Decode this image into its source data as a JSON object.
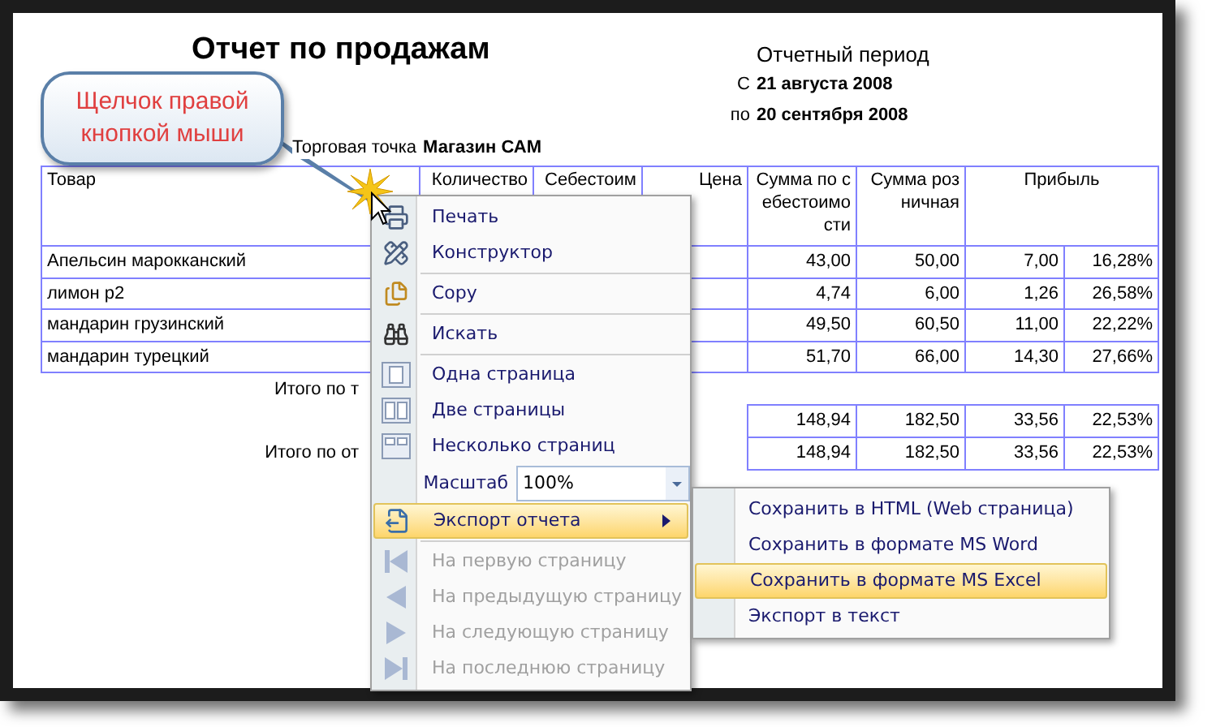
{
  "report": {
    "title": "Отчет по продажам",
    "period_label": "Отчетный период",
    "period_from": {
      "prefix": "С",
      "date": "21 августа 2008"
    },
    "period_to": {
      "prefix": "по",
      "date": "20 сентября 2008"
    },
    "store": {
      "label": "Торговая точка",
      "name": "Магазин САМ"
    }
  },
  "table": {
    "columns": [
      "Товар",
      "Количество",
      "Себестоим",
      "Цена",
      "Сумма по себестоимости",
      "Сумма розничная",
      "Прибыль"
    ],
    "rows": [
      {
        "product": "Апельсин марокканский",
        "cost_sum": "43,00",
        "retail_sum": "50,00",
        "profit": "7,00",
        "profit_pct": "16,28%"
      },
      {
        "product": "лимон p2",
        "cost_sum": "4,74",
        "retail_sum": "6,00",
        "profit": "1,26",
        "profit_pct": "26,58%"
      },
      {
        "product": "мандарин грузинский",
        "cost_sum": "49,50",
        "retail_sum": "60,50",
        "profit": "11,00",
        "profit_pct": "22,22%"
      },
      {
        "product": "мандарин турецкий",
        "cost_sum": "51,70",
        "retail_sum": "66,00",
        "profit": "14,30",
        "profit_pct": "27,66%"
      }
    ],
    "totals": [
      {
        "label": "Итого по т",
        "cost_sum": "148,94",
        "retail_sum": "182,50",
        "profit": "33,56",
        "profit_pct": "22,53%"
      },
      {
        "label": "Итого по от",
        "cost_sum": "148,94",
        "retail_sum": "182,50",
        "profit": "33,56",
        "profit_pct": "22,53%"
      }
    ]
  },
  "callout": {
    "text": "Щелчок правой кнопкой мыши"
  },
  "context_menu": {
    "items": [
      {
        "kind": "item",
        "label": "Печать",
        "disabled": false,
        "selected": false
      },
      {
        "kind": "item",
        "label": "Конструктор",
        "disabled": false,
        "selected": false
      },
      {
        "kind": "separator"
      },
      {
        "kind": "item",
        "label": "Copy",
        "disabled": false,
        "selected": false
      },
      {
        "kind": "separator"
      },
      {
        "kind": "item",
        "label": "Искать",
        "disabled": false,
        "selected": false
      },
      {
        "kind": "separator"
      },
      {
        "kind": "item",
        "label": "Одна страница",
        "disabled": false,
        "selected": false
      },
      {
        "kind": "item",
        "label": "Две страницы",
        "disabled": false,
        "selected": false
      },
      {
        "kind": "item",
        "label": "Несколько страниц",
        "disabled": false,
        "selected": false
      },
      {
        "kind": "zoom",
        "label": "Масштаб",
        "value": "100%"
      },
      {
        "kind": "submenu",
        "label": "Экспорт отчета",
        "disabled": false,
        "selected": true
      },
      {
        "kind": "separator"
      },
      {
        "kind": "item",
        "label": "На первую страницу",
        "disabled": true,
        "selected": false
      },
      {
        "kind": "item",
        "label": "На предыдущую страницу",
        "disabled": true,
        "selected": false
      },
      {
        "kind": "item",
        "label": "На следующую страницу",
        "disabled": true,
        "selected": false
      },
      {
        "kind": "item",
        "label": "На последнюю страницу",
        "disabled": true,
        "selected": false
      }
    ]
  },
  "submenu": {
    "items": [
      {
        "label": "Сохранить в HTML (Web страница)",
        "selected": false
      },
      {
        "label": "Сохранить в формате MS Word",
        "selected": false
      },
      {
        "label": "Сохранить в формате MS Excel",
        "selected": true
      },
      {
        "label": "Экспорт в текст",
        "selected": false
      }
    ]
  }
}
